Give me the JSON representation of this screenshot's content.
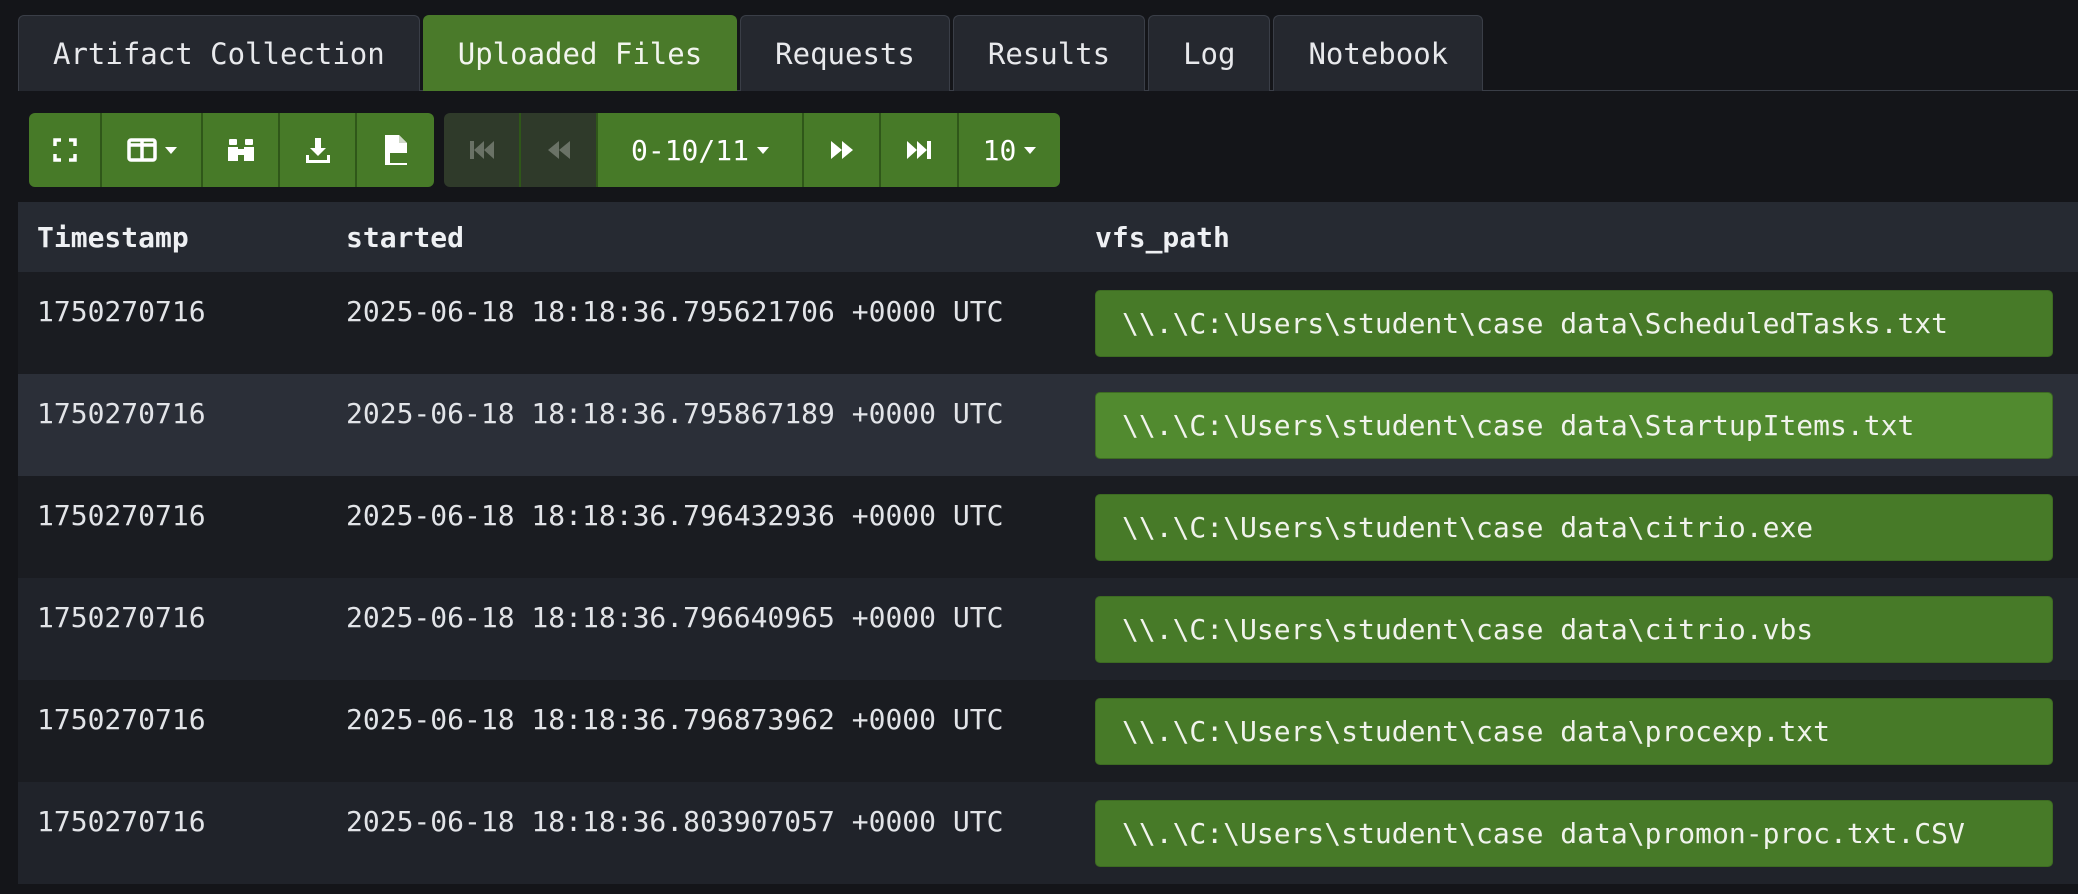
{
  "tabs": [
    {
      "label": "Artifact Collection",
      "active": false
    },
    {
      "label": "Uploaded Files",
      "active": true
    },
    {
      "label": "Requests",
      "active": false
    },
    {
      "label": "Results",
      "active": false
    },
    {
      "label": "Log",
      "active": false
    },
    {
      "label": "Notebook",
      "active": false
    }
  ],
  "toolbar": {
    "icons": [
      "fullscreen-icon",
      "columns-icon",
      "binoculars-icon",
      "download-icon",
      "csv-file-icon"
    ],
    "pagination": {
      "range_label": "0-10/11",
      "page_size_label": "10"
    }
  },
  "table": {
    "headers": {
      "timestamp": "Timestamp",
      "started": "started",
      "vfs_path": "vfs_path"
    },
    "rows": [
      {
        "timestamp": "1750270716",
        "started": "2025-06-18 18:18:36.795621706 +0000 UTC",
        "vfs_path": "\\\\.\\C:\\Users\\student\\case data\\ScheduledTasks.txt"
      },
      {
        "timestamp": "1750270716",
        "started": "2025-06-18 18:18:36.795867189 +0000 UTC",
        "vfs_path": "\\\\.\\C:\\Users\\student\\case data\\StartupItems.txt"
      },
      {
        "timestamp": "1750270716",
        "started": "2025-06-18 18:18:36.796432936 +0000 UTC",
        "vfs_path": "\\\\.\\C:\\Users\\student\\case data\\citrio.exe"
      },
      {
        "timestamp": "1750270716",
        "started": "2025-06-18 18:18:36.796640965 +0000 UTC",
        "vfs_path": "\\\\.\\C:\\Users\\student\\case data\\citrio.vbs"
      },
      {
        "timestamp": "1750270716",
        "started": "2025-06-18 18:18:36.796873962 +0000 UTC",
        "vfs_path": "\\\\.\\C:\\Users\\student\\case data\\procexp.txt"
      },
      {
        "timestamp": "1750270716",
        "started": "2025-06-18 18:18:36.803907057 +0000 UTC",
        "vfs_path": "\\\\.\\C:\\Users\\student\\case data\\promon-proc.txt.CSV"
      }
    ]
  },
  "colors": {
    "accent": "#477a28",
    "background": "#141519",
    "header": "#262a32"
  }
}
